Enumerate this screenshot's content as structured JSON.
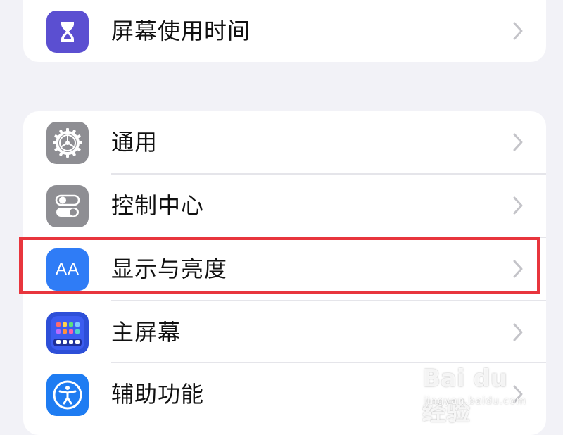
{
  "settings": {
    "top_group": [
      {
        "label": "屏幕使用时间",
        "icon": "hourglass-icon",
        "icon_color": "#5b4fd1"
      }
    ],
    "main_group": [
      {
        "label": "通用",
        "icon": "gear-icon",
        "icon_color": "#8e8e93"
      },
      {
        "label": "控制中心",
        "icon": "toggle-switches-icon",
        "icon_color": "#8e8e93"
      },
      {
        "label": "显示与亮度",
        "icon": "text-size-aa-icon",
        "icon_color": "#2f7cf6"
      },
      {
        "label": "主屏幕",
        "icon": "home-screen-grid-icon",
        "icon_color": "#2d4fd8"
      },
      {
        "label": "辅助功能",
        "icon": "accessibility-icon",
        "icon_color": "#1e7cf2"
      }
    ],
    "aa_icon_text": "AA",
    "highlighted_item": "显示与亮度",
    "highlight_color": "#e8353d"
  },
  "watermark": {
    "main": "Bai du 经验",
    "sub": "jingyan.baidu.com"
  }
}
